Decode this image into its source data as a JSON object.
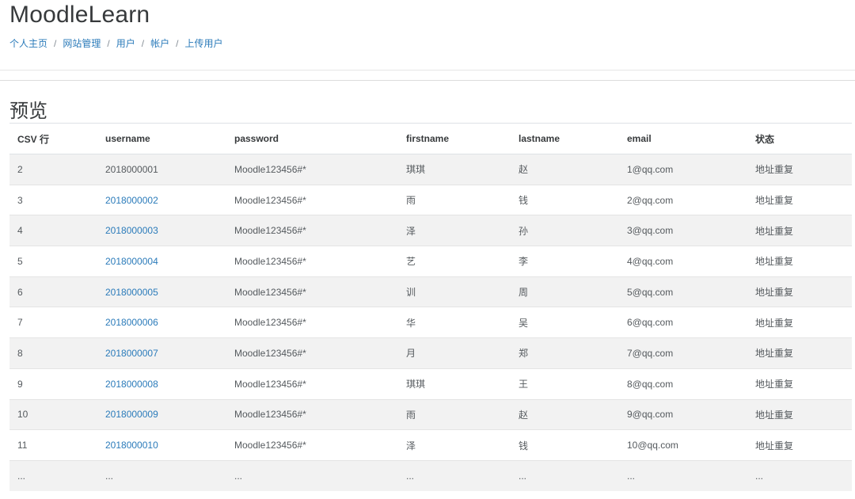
{
  "site": {
    "title": "MoodleLearn"
  },
  "breadcrumb": [
    "个人主页",
    "网站管理",
    "用户",
    "帐户",
    "上传用户"
  ],
  "breadcrumb_separator": "/",
  "section": {
    "title": "预览"
  },
  "table": {
    "headers": [
      "CSV 行",
      "username",
      "password",
      "firstname",
      "lastname",
      "email",
      "状态"
    ],
    "rows": [
      [
        "2",
        "2018000001",
        "Moodle123456#*",
        "琪琪",
        "赵",
        "1@qq.com",
        "地址重复"
      ],
      [
        "3",
        "2018000002",
        "Moodle123456#*",
        "雨",
        "钱",
        "2@qq.com",
        "地址重复"
      ],
      [
        "4",
        "2018000003",
        "Moodle123456#*",
        "泽",
        "孙",
        "3@qq.com",
        "地址重复"
      ],
      [
        "5",
        "2018000004",
        "Moodle123456#*",
        "艺",
        "李",
        "4@qq.com",
        "地址重复"
      ],
      [
        "6",
        "2018000005",
        "Moodle123456#*",
        "训",
        "周",
        "5@qq.com",
        "地址重复"
      ],
      [
        "7",
        "2018000006",
        "Moodle123456#*",
        "华",
        "吴",
        "6@qq.com",
        "地址重复"
      ],
      [
        "8",
        "2018000007",
        "Moodle123456#*",
        "月",
        "郑",
        "7@qq.com",
        "地址重复"
      ],
      [
        "9",
        "2018000008",
        "Moodle123456#*",
        "琪琪",
        "王",
        "8@qq.com",
        "地址重复"
      ],
      [
        "10",
        "2018000009",
        "Moodle123456#*",
        "雨",
        "赵",
        "9@qq.com",
        "地址重复"
      ],
      [
        "11",
        "2018000010",
        "Moodle123456#*",
        "泽",
        "钱",
        "10@qq.com",
        "地址重复"
      ],
      [
        "...",
        "...",
        "...",
        "...",
        "...",
        "...",
        "..."
      ]
    ],
    "username_linked": [
      false,
      true,
      true,
      true,
      true,
      true,
      true,
      true,
      true,
      true,
      false
    ]
  }
}
